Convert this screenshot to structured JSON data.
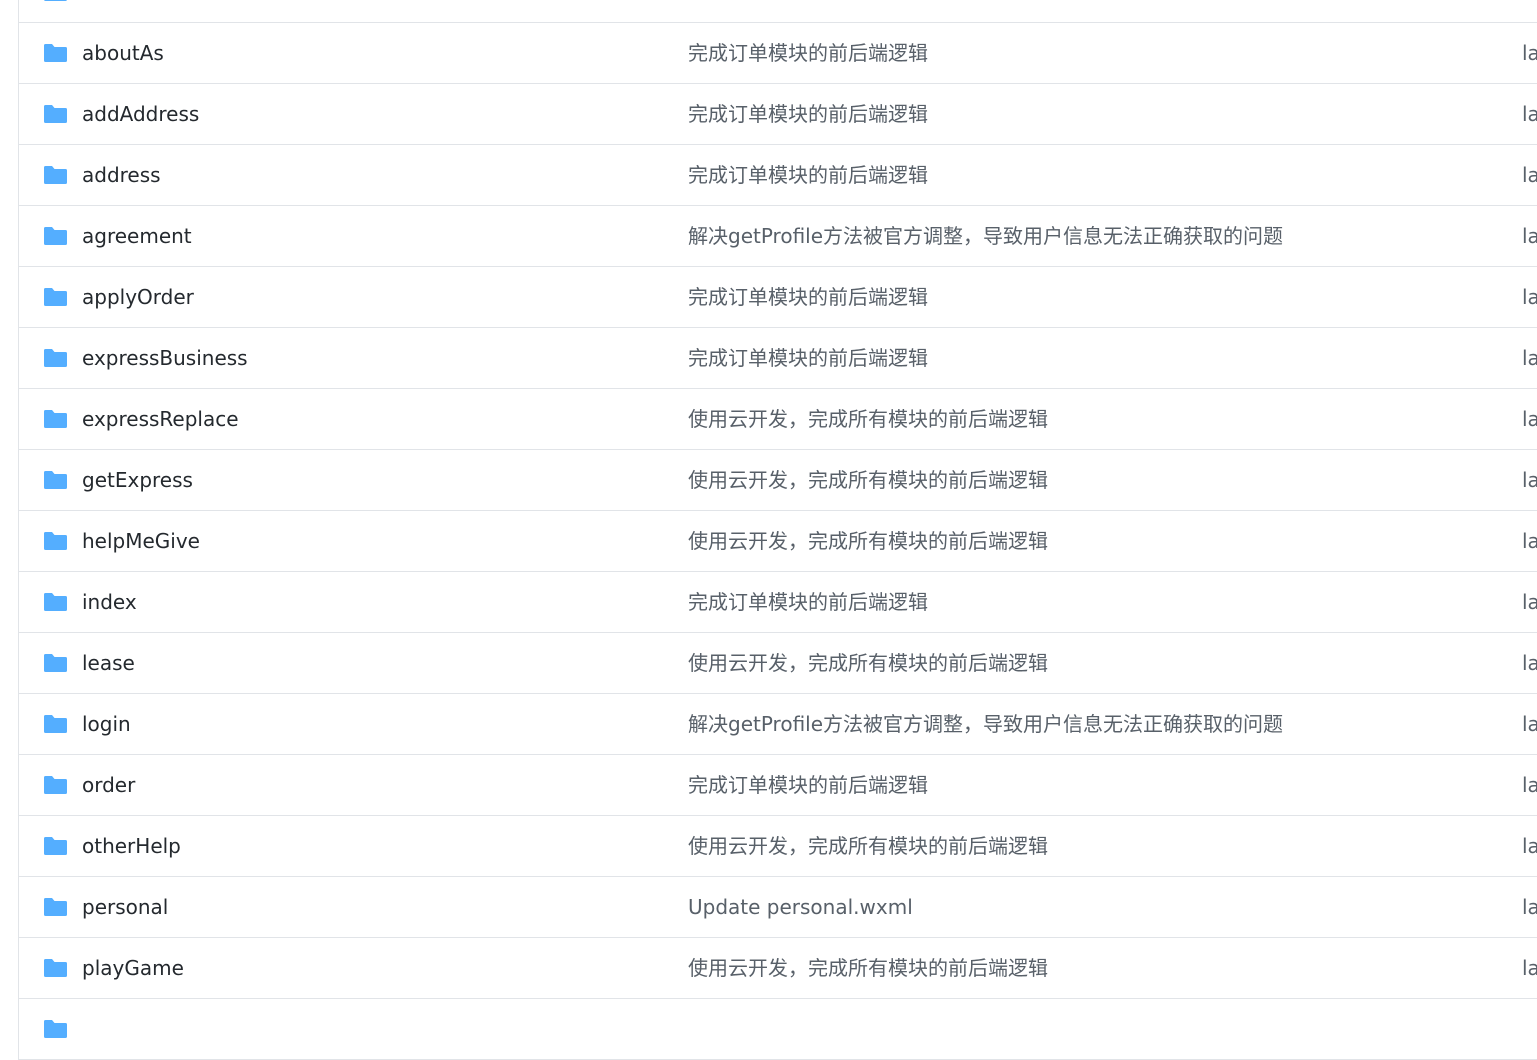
{
  "colors": {
    "folder": "#54aeff",
    "border": "#e1e4e8",
    "name_text": "#24292e",
    "message_text": "#586069"
  },
  "icon": "folder-icon",
  "rows": [
    {
      "name": "",
      "message": "",
      "age": ""
    },
    {
      "name": "aboutAs",
      "message": "完成订单模块的前后端逻辑",
      "age": "la"
    },
    {
      "name": "addAddress",
      "message": "完成订单模块的前后端逻辑",
      "age": "la"
    },
    {
      "name": "address",
      "message": "完成订单模块的前后端逻辑",
      "age": "la"
    },
    {
      "name": "agreement",
      "message": "解决getProfile方法被官方调整，导致用户信息无法正确获取的问题",
      "age": "la"
    },
    {
      "name": "applyOrder",
      "message": "完成订单模块的前后端逻辑",
      "age": "la"
    },
    {
      "name": "expressBusiness",
      "message": "完成订单模块的前后端逻辑",
      "age": "la"
    },
    {
      "name": "expressReplace",
      "message": "使用云开发，完成所有模块的前后端逻辑",
      "age": "la"
    },
    {
      "name": "getExpress",
      "message": "使用云开发，完成所有模块的前后端逻辑",
      "age": "la"
    },
    {
      "name": "helpMeGive",
      "message": "使用云开发，完成所有模块的前后端逻辑",
      "age": "la"
    },
    {
      "name": "index",
      "message": "完成订单模块的前后端逻辑",
      "age": "la"
    },
    {
      "name": "lease",
      "message": "使用云开发，完成所有模块的前后端逻辑",
      "age": "la"
    },
    {
      "name": "login",
      "message": "解决getProfile方法被官方调整，导致用户信息无法正确获取的问题",
      "age": "la"
    },
    {
      "name": "order",
      "message": "完成订单模块的前后端逻辑",
      "age": "la"
    },
    {
      "name": "otherHelp",
      "message": "使用云开发，完成所有模块的前后端逻辑",
      "age": "la"
    },
    {
      "name": "personal",
      "message": "Update personal.wxml",
      "age": "la"
    },
    {
      "name": "playGame",
      "message": "使用云开发，完成所有模块的前后端逻辑",
      "age": "la"
    },
    {
      "name": "",
      "message": "",
      "age": ""
    }
  ]
}
